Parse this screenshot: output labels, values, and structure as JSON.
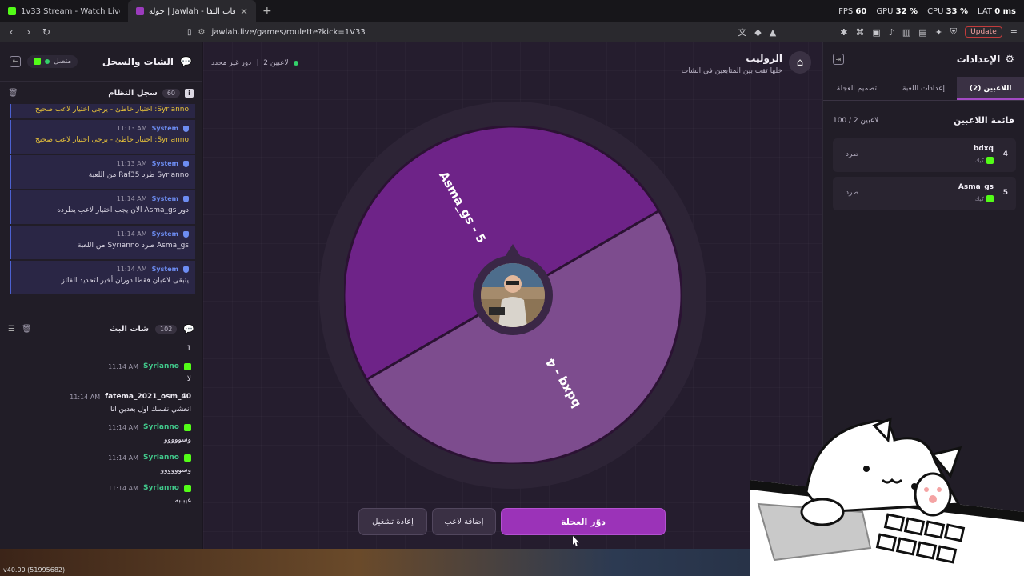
{
  "browser": {
    "tabs": [
      {
        "title": "1v33 Stream - Watch Live on Kick",
        "active": false
      },
      {
        "title": "جولة | Jawlah - منصة الألعاب التفا",
        "active": true
      }
    ],
    "new_tab": "+",
    "stats": {
      "fps_label": "FPS",
      "fps": "60",
      "gpu_label": "GPU",
      "gpu": "32 %",
      "cpu_label": "CPU",
      "cpu": "33 %",
      "lat_label": "LAT",
      "lat": "0 ms"
    },
    "url": "jawlah.live/games/roulette?kick=1V33",
    "update_label": "Update"
  },
  "chat": {
    "title": "الشات والسجل",
    "status": "متصل",
    "system_log": {
      "title": "سجل النظام",
      "count": "60",
      "items": [
        {
          "who": "",
          "time": "",
          "text": "Syrianno: اختيار خاطئ - يرجى اختيار لاعب صحيح",
          "warn": true
        },
        {
          "who": "System",
          "time": "11:13 AM",
          "text": "Syrianno: اختيار خاطئ - يرجى اختيار لاعب صحيح",
          "warn": true
        },
        {
          "who": "System",
          "time": "11:13 AM",
          "text": "Syrianno طرد Raf35 من اللعبة",
          "warn": false
        },
        {
          "who": "System",
          "time": "11:14 AM",
          "text": "دور Asma_gs الان يجب اختيار لاعب يطرده",
          "warn": false
        },
        {
          "who": "System",
          "time": "11:14 AM",
          "text": "Asma_gs طرد Syrianno من اللعبة",
          "warn": false
        },
        {
          "who": "System",
          "time": "11:14 AM",
          "text": "يتبقى لاعبان فقطا دوران أخير لتحديد الفائز",
          "warn": false
        }
      ]
    },
    "stream_chat": {
      "title": "شات البث",
      "count": "102",
      "messages": [
        {
          "user": "",
          "time": "",
          "text": "1"
        },
        {
          "user": "Syrlanno",
          "time": "11:14 AM",
          "text": "لا",
          "color": "green"
        },
        {
          "user": "fatema_2021_osm_40",
          "time": "11:14 AM",
          "text": "انعشي نفسك اول بعدين انا",
          "color": "white"
        },
        {
          "user": "Syrlanno",
          "time": "11:14 AM",
          "text": "وسووووو",
          "color": "green"
        },
        {
          "user": "Syrlanno",
          "time": "11:14 AM",
          "text": "وسوووووو",
          "color": "green"
        },
        {
          "user": "Syrlanno",
          "time": "11:14 AM",
          "text": "غيبببه",
          "color": "green"
        }
      ]
    }
  },
  "game": {
    "title": "الروليت",
    "subtitle": "خلها تقب بين المتابعين في الشات",
    "players_count_text": "2 لاعبين",
    "turn_text": "دور غير محدد",
    "wheel": {
      "segments": [
        {
          "label": "Asma_gs - 5",
          "color": "#6e2388"
        },
        {
          "label": "bdxq - 4",
          "color": "#7d4c8e"
        }
      ]
    },
    "buttons": {
      "restart": "إعادة تشغيل",
      "add_player": "إضافة لاعب",
      "spin": "دوّر العجلة"
    }
  },
  "settings": {
    "title": "الإعدادات",
    "tabs": [
      {
        "label": "اللاعبين (2)",
        "active": true
      },
      {
        "label": "إعدادات اللعبة",
        "active": false
      },
      {
        "label": "تصميم العجلة",
        "active": false
      }
    ],
    "list_title": "قائمة اللاعبين",
    "list_count": "100 / 2 لاعبين",
    "players": [
      {
        "num": "4",
        "name": "bdxq",
        "source": "كيك",
        "kick_label": "طرد"
      },
      {
        "num": "5",
        "name": "Asma_gs",
        "source": "كيك",
        "kick_label": "طرد"
      }
    ]
  },
  "footer": {
    "version": "v40.00 (51995682)"
  }
}
